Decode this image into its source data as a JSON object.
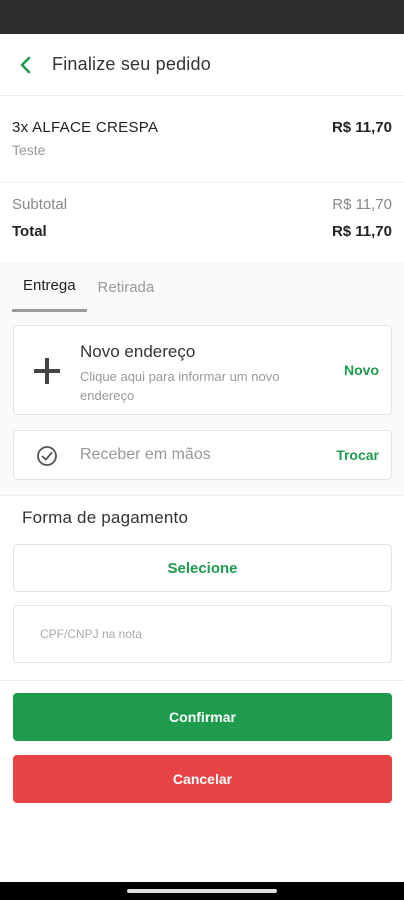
{
  "header": {
    "title": "Finalize seu pedido"
  },
  "item": {
    "name": "3x ALFACE CRESPA",
    "note": "Teste",
    "price": "R$ 11,70"
  },
  "totals": {
    "subtotal_label": "Subtotal",
    "subtotal_value": "R$ 11,70",
    "total_label": "Total",
    "total_value": "R$ 11,70"
  },
  "tabs": [
    {
      "label": "Entrega",
      "active": true
    },
    {
      "label": "Retirada",
      "active": false
    }
  ],
  "address": {
    "title": "Novo endereço",
    "subtitle": "Clique aqui para informar um novo endereço",
    "action": "Novo"
  },
  "receive": {
    "label": "Receber em mãos",
    "action": "Trocar"
  },
  "payment": {
    "title": "Forma de pagamento",
    "select_label": "Selecione",
    "cpf_placeholder": "CPF/CNPJ na nota",
    "cpf_value": ""
  },
  "actions": {
    "confirm": "Confirmar",
    "cancel": "Cancelar"
  },
  "colors": {
    "accent": "#1e9b4d",
    "danger": "#e84445",
    "status_bar": "#2d2d2d"
  },
  "icons": {
    "back": "chevron-left-icon",
    "plus": "plus-icon",
    "check": "check-circle-icon"
  }
}
